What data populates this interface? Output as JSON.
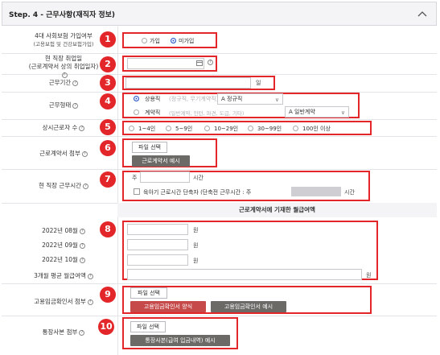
{
  "header": {
    "title": "Step. 4 - 근무사항(재직자 정보)"
  },
  "rows": {
    "insurance": {
      "label_line1": "4대 사회보험 가입여부",
      "label_line2": "(고용보험 및 건강보험가입)",
      "options": [
        "가입",
        "미가입"
      ]
    },
    "hire_date": {
      "label_line1": "현 직장 취업일",
      "label_line2": "(근로계약서 상의 취업일자)"
    },
    "work_period": {
      "label": "근무기간",
      "unit": "일"
    },
    "employment_type": {
      "label": "근무형태",
      "regular": "상용직",
      "regular_hint": "(정규직, 무기계약직)",
      "regular_select": "A 정규직",
      "contract": "계약직",
      "contract_hint": "(일반계약, 인턴, 파견, 도급, 기타)",
      "contract_select": "A 일반계약"
    },
    "employees": {
      "label": "상시근로자 수",
      "options": [
        "1~4인",
        "5~9인",
        "10~29인",
        "30~99인",
        "100인 이상"
      ]
    },
    "contract_attach": {
      "label": "근로계약서 첨부",
      "file_button": "파일 선택",
      "example_button": "근로계약서 예시"
    },
    "work_hours": {
      "label": "현 직장 근무시간",
      "prefix": "주",
      "unit": "시간",
      "childcare_text": "육아기 근로시간 단축자 (단축전 근무시간 : 주",
      "childcare_unit": "시간"
    }
  },
  "wage_section": {
    "title": "근로계약서에 기재한 월급여액",
    "months": [
      {
        "label": "2022년 08월",
        "unit": "원"
      },
      {
        "label": "2022년 09월",
        "unit": "원"
      },
      {
        "label": "2022년 10월",
        "unit": "원"
      }
    ],
    "average": {
      "label": "3개월 평균 월급여액",
      "unit": "원"
    }
  },
  "wage_attach": {
    "label": "고용임금확인서 첨부",
    "file_button": "파일 선택",
    "form_button": "고용임금확인서 양식",
    "example_button": "고용임금확인서 예시"
  },
  "bankbook_attach": {
    "label": "통장사본 첨부",
    "file_button": "파일 선택",
    "example_button": "통장사본(급여 입금내역) 예시"
  },
  "badges": [
    "1",
    "2",
    "3",
    "4",
    "5",
    "6",
    "7",
    "8",
    "9",
    "10"
  ],
  "colors": {
    "highlight": "#e3262a",
    "radio_on": "#2a55c9"
  }
}
